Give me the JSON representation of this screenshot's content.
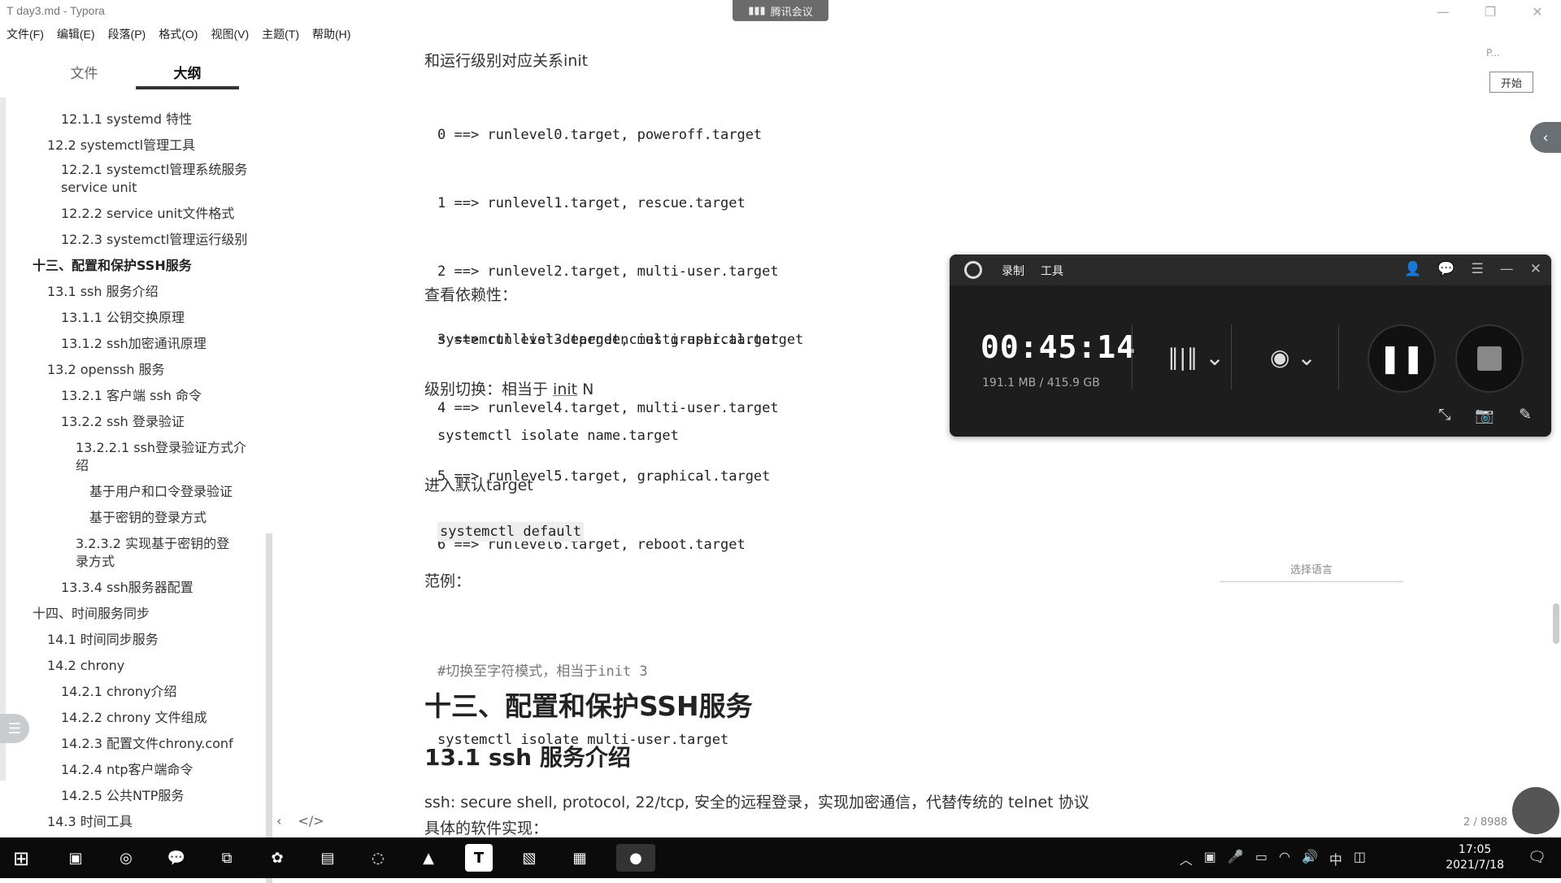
{
  "window": {
    "title": "day3.md - Typora",
    "app_icon": "T"
  },
  "meeting_badge": "腾讯会议",
  "menu": [
    "文件(F)",
    "编辑(E)",
    "段落(P)",
    "格式(O)",
    "视图(V)",
    "主题(T)",
    "帮助(H)"
  ],
  "sidebar": {
    "tabs": [
      "文件",
      "大纲"
    ],
    "outline": [
      "12.1.1 systemd 特性",
      "12.2 systemctl管理工具",
      "12.2.1 systemctl管理系统服务",
      "service unit",
      "12.2.2 service unit文件格式",
      "12.2.3 systemctl管理运行级别",
      "十三、配置和保护SSH服务",
      "13.1 ssh 服务介绍",
      "13.1.1 公钥交换原理",
      "13.1.2 ssh加密通讯原理",
      "13.2 openssh 服务",
      "13.2.1 客户端 ssh 命令",
      "13.2.2 ssh 登录验证",
      "13.2.2.1 ssh登录验证方式介",
      "绍",
      "基于用户和口令登录验证",
      "基于密钥的登录方式",
      "3.2.3.2 实现基于密钥的登",
      "录方式",
      "13.3.4 ssh服务器配置",
      "十四、时间服务同步",
      "14.1 时间同步服务",
      "14.2 chrony",
      "14.2.1 chrony介绍",
      "14.2.2 chrony 文件组成",
      "14.2.3 配置文件chrony.conf",
      "14.2.4 ntp客户端命令",
      "14.2.5 公共NTP服务",
      "14.3 时间工具"
    ],
    "bottom_left": "‹",
    "bottom_code": "</>"
  },
  "content": {
    "p1": "和运行级别对应关系init",
    "runlevels": [
      "0 ==> runlevel0.target, poweroff.target",
      "1 ==> runlevel1.target, rescue.target",
      "2 ==> runlevel2.target, multi-user.target",
      "3 ==> runlevel3.target, multi-user.target",
      "4 ==> runlevel4.target, multi-user.target",
      "5 ==> runlevel5.target, graphical.target",
      "6 ==> runlevel6.target, reboot.target"
    ],
    "p2": "查看依赖性：",
    "code2": "systemctl list-dependencies graphical.target",
    "p3_prefix": "级别切换：相当于 ",
    "p3_link": "init",
    "p3_suffix": " N",
    "code3": "systemctl isolate name.target",
    "p4": "进入默认target",
    "code4": "systemctl default",
    "p5": "范例：",
    "code5_comment": "#切换至字符模式，相当于init 3",
    "code5": "systemctl isolate multi-user.target",
    "h1": "十三、配置和保护SSH服务",
    "h2": "13.1 ssh 服务介绍",
    "p6": "ssh: secure shell, protocol, 22/tcp, 安全的远程登录，实现加密通信，代替传统的 telnet 协议",
    "p7": "具体的软件实现："
  },
  "recorder": {
    "tab_record": "录制",
    "tab_tools": "工具",
    "time": "00:45:14",
    "storage": "191.1 MB / 415.9 GB"
  },
  "right_panel": {
    "label": "P...",
    "start_button": "开始",
    "language": "选择语言",
    "word_count": "2 / 8988"
  },
  "taskbar": {
    "time": "17:05",
    "date": "2021/7/18",
    "ime": "中"
  }
}
